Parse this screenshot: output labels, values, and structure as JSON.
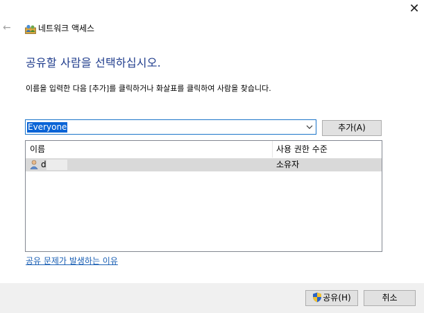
{
  "window": {
    "title": "네트워크 액세스",
    "close_glyph": "✕",
    "back_glyph": "←",
    "icons": {
      "title": "network-users-icon",
      "back": "back-arrow-icon",
      "close": "close-icon"
    }
  },
  "main": {
    "heading": "공유할 사람을 선택하십시오.",
    "instruction": "이름을 입력한 다음 [추가]를 클릭하거나 화살표를 클릭하여 사람을 찾습니다.",
    "combo": {
      "value": "Everyone",
      "icon": "chevron-down-icon"
    },
    "add_label": "추가(A)",
    "list": {
      "columns": [
        "이름",
        "사용 권한 수준"
      ],
      "rows": [
        {
          "name": "d",
          "permission": "소유자",
          "icon": "user-icon",
          "selected": true
        }
      ]
    },
    "help_link": "공유 문제가 발생하는 이유"
  },
  "footer": {
    "share_label": "공유(H)",
    "share_icon": "uac-shield-icon",
    "cancel_label": "취소"
  },
  "colors": {
    "heading": "#1f3c8c",
    "link": "#1a5fb4",
    "selection": "#0a64d6",
    "row_selected": "#d9d9d9",
    "footer_bg": "#f0f0f0"
  }
}
